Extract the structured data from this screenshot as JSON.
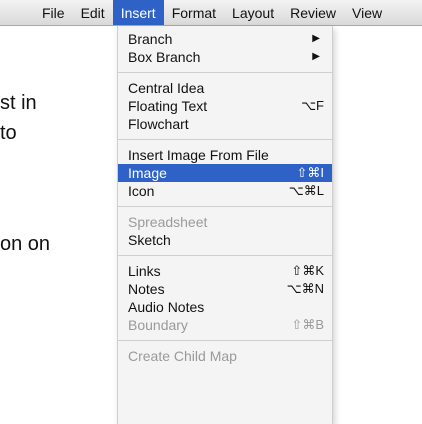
{
  "menubar": {
    "items": [
      "File",
      "Edit",
      "Insert",
      "Format",
      "Layout",
      "Review",
      "View"
    ]
  },
  "background": {
    "lines": [
      "st in",
      "to",
      "on on"
    ]
  },
  "menu": {
    "groups": [
      [
        {
          "label": "Branch",
          "shortcut": "",
          "submenu": true,
          "disabled": false,
          "highlighted": false
        },
        {
          "label": "Box Branch",
          "shortcut": "",
          "submenu": true,
          "disabled": false,
          "highlighted": false
        }
      ],
      [
        {
          "label": "Central Idea",
          "shortcut": "",
          "submenu": false,
          "disabled": false,
          "highlighted": false
        },
        {
          "label": "Floating Text",
          "shortcut": "⌥F",
          "submenu": false,
          "disabled": false,
          "highlighted": false
        },
        {
          "label": "Flowchart",
          "shortcut": "",
          "submenu": false,
          "disabled": false,
          "highlighted": false
        }
      ],
      [
        {
          "label": "Insert Image From File",
          "shortcut": "",
          "submenu": false,
          "disabled": false,
          "highlighted": false
        },
        {
          "label": "Image",
          "shortcut": "⇧⌘I",
          "submenu": false,
          "disabled": false,
          "highlighted": true
        },
        {
          "label": "Icon",
          "shortcut": "⌥⌘L",
          "submenu": false,
          "disabled": false,
          "highlighted": false
        }
      ],
      [
        {
          "label": "Spreadsheet",
          "shortcut": "",
          "submenu": false,
          "disabled": true,
          "highlighted": false
        },
        {
          "label": "Sketch",
          "shortcut": "",
          "submenu": false,
          "disabled": false,
          "highlighted": false
        }
      ],
      [
        {
          "label": "Links",
          "shortcut": "⇧⌘K",
          "submenu": false,
          "disabled": false,
          "highlighted": false
        },
        {
          "label": "Notes",
          "shortcut": "⌥⌘N",
          "submenu": false,
          "disabled": false,
          "highlighted": false
        },
        {
          "label": "Audio Notes",
          "shortcut": "",
          "submenu": false,
          "disabled": false,
          "highlighted": false
        },
        {
          "label": "Boundary",
          "shortcut": "⇧⌘B",
          "submenu": false,
          "disabled": true,
          "highlighted": false
        }
      ],
      [
        {
          "label": "Create Child Map",
          "shortcut": "",
          "submenu": false,
          "disabled": true,
          "highlighted": false
        }
      ]
    ]
  },
  "colors": {
    "highlight": "#2f62c6",
    "menu_bg": "#f4f4f4",
    "disabled_text": "#9a9a9a"
  }
}
